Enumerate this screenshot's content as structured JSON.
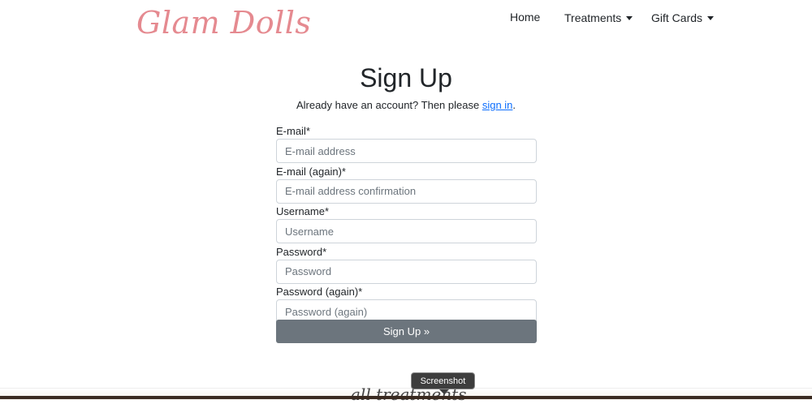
{
  "brand": "Glam Dolls",
  "nav": {
    "home": "Home",
    "treatments": "Treatments",
    "gift_cards": "Gift Cards"
  },
  "page": {
    "title": "Sign Up",
    "subtitle_prefix": "Already have an account? Then please ",
    "subtitle_link": "sign in",
    "subtitle_suffix": "."
  },
  "form": {
    "email_label": "E-mail*",
    "email_placeholder": "E-mail address",
    "email2_label": "E-mail (again)*",
    "email2_placeholder": "E-mail address confirmation",
    "username_label": "Username*",
    "username_placeholder": "Username",
    "password_label": "Password*",
    "password_placeholder": "Password",
    "password2_label": "Password (again)*",
    "password2_placeholder": "Password (again)",
    "submit_label": "Sign Up »"
  },
  "footer": {
    "script_text": "all treatments"
  },
  "tooltip": "Screenshot",
  "colors": {
    "brand": "#e58a90",
    "link": "#0d6efd",
    "button": "#6c757d"
  }
}
